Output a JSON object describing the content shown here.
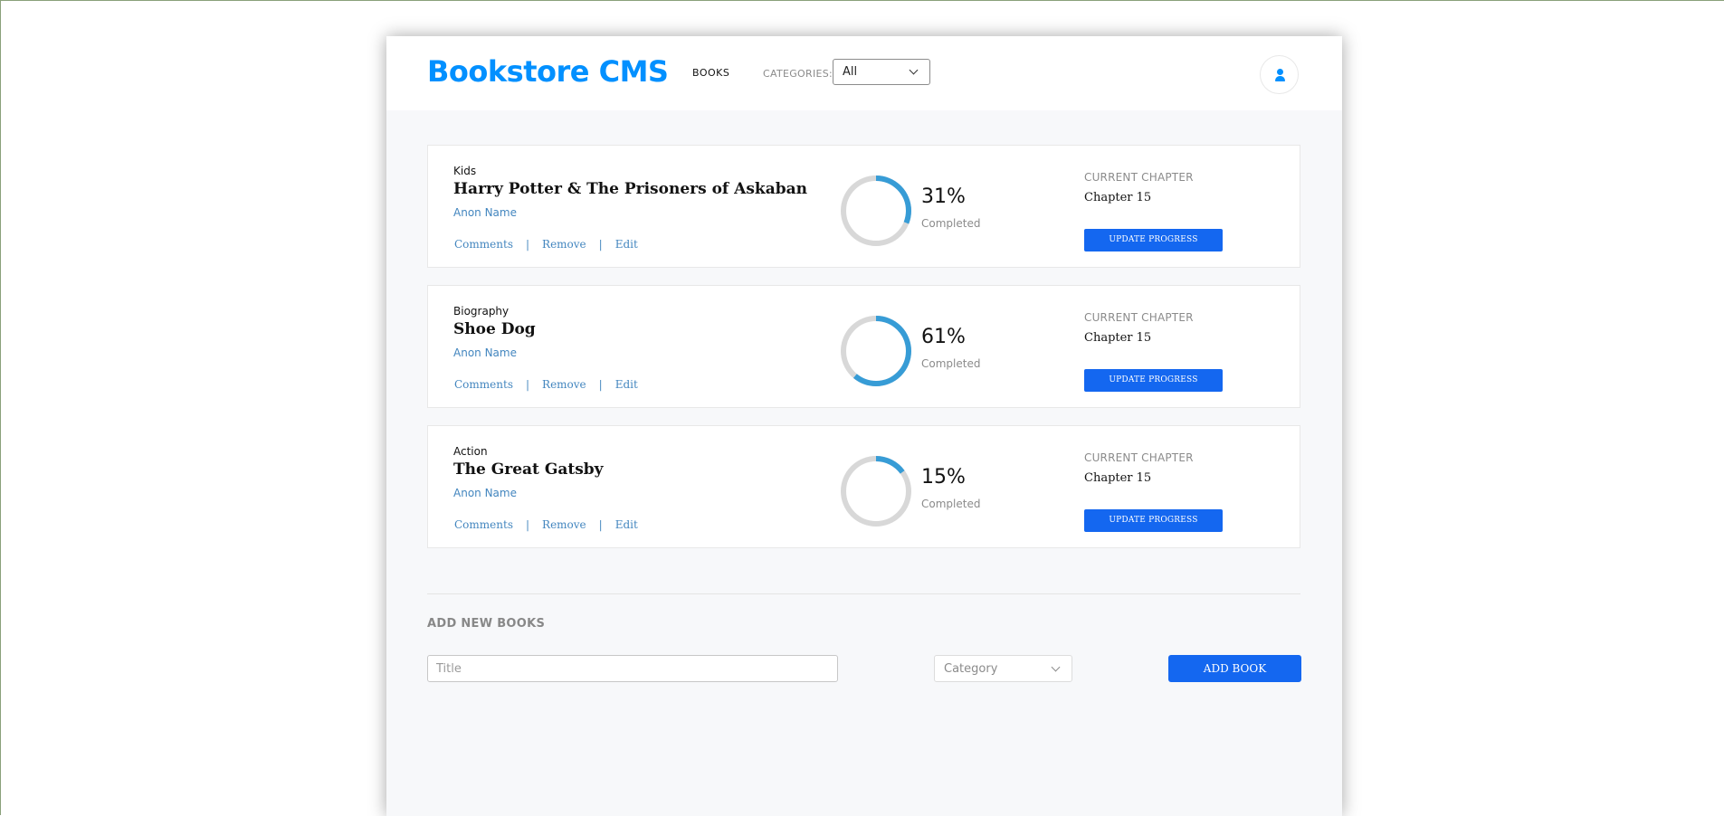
{
  "header": {
    "logo": "Bookstore CMS",
    "nav_books": "BOOKS",
    "categories_label": "CATEGORIES:",
    "categories_value": "All",
    "user_icon": "user-icon"
  },
  "colors": {
    "brand": "#0290ff",
    "button": "#1467f0",
    "ring_progress": "#379cd6",
    "ring_track": "#d8d8d8"
  },
  "books": [
    {
      "genre": "Kids",
      "title": "Harry Potter & The Prisoners of Askaban",
      "author": "Anon Name",
      "actions": [
        "Comments",
        "Remove",
        "Edit"
      ],
      "percent": 31,
      "percent_label": "31%",
      "completed_label": "Completed",
      "current_chapter_label": "CURRENT CHAPTER",
      "current_chapter": "Chapter 15",
      "update_label": "UPDATE PROGRESS"
    },
    {
      "genre": "Biography",
      "title": "Shoe Dog",
      "author": "Anon Name",
      "actions": [
        "Comments",
        "Remove",
        "Edit"
      ],
      "percent": 61,
      "percent_label": "61%",
      "completed_label": "Completed",
      "current_chapter_label": "CURRENT CHAPTER",
      "current_chapter": "Chapter 15",
      "update_label": "UPDATE PROGRESS"
    },
    {
      "genre": "Action",
      "title": "The Great Gatsby",
      "author": "Anon Name",
      "actions": [
        "Comments",
        "Remove",
        "Edit"
      ],
      "percent": 15,
      "percent_label": "15%",
      "completed_label": "Completed",
      "current_chapter_label": "CURRENT CHAPTER",
      "current_chapter": "Chapter 15",
      "update_label": "UPDATE PROGRESS"
    }
  ],
  "add_form": {
    "heading": "ADD NEW BOOKS",
    "title_placeholder": "Title",
    "title_value": "",
    "category_placeholder": "Category",
    "submit_label": "ADD BOOK"
  }
}
